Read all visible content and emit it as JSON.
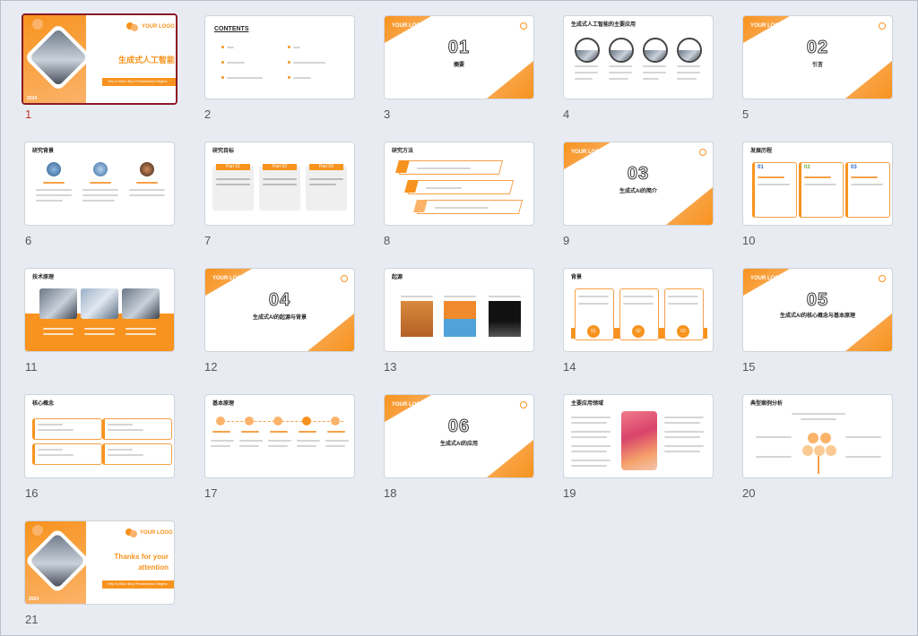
{
  "slides": [
    {
      "n": "1",
      "logo": "YOUR LOGO",
      "title": "生成式人工智能",
      "subtitle": "Hey Is Elton Bey Presentation Begins",
      "tag": "2024"
    },
    {
      "n": "2",
      "title": "CONTENTS"
    },
    {
      "n": "3",
      "logo": "YOUR LOGO",
      "num": "01",
      "title": "摘要"
    },
    {
      "n": "4",
      "title": "生成式人工智能的主要应用"
    },
    {
      "n": "5",
      "logo": "YOUR LOGO",
      "num": "02",
      "title": "引言"
    },
    {
      "n": "6",
      "title": "研究背景"
    },
    {
      "n": "7",
      "title": "研究目标",
      "parts": [
        "Part 01",
        "Part 02",
        "Part 03"
      ]
    },
    {
      "n": "8",
      "title": "研究方法"
    },
    {
      "n": "9",
      "logo": "YOUR LOGO",
      "num": "03",
      "title": "生成式AI的简介"
    },
    {
      "n": "10",
      "title": "发展历程",
      "cards": [
        "01",
        "02",
        "03"
      ]
    },
    {
      "n": "11",
      "title": "技术原理"
    },
    {
      "n": "12",
      "logo": "YOUR LOGO",
      "num": "04",
      "title": "生成式AI的起源与背景"
    },
    {
      "n": "13",
      "title": "起源"
    },
    {
      "n": "14",
      "title": "背景",
      "cards": [
        "01",
        "02",
        "03"
      ]
    },
    {
      "n": "15",
      "logo": "YOUR LOGO",
      "num": "05",
      "title": "生成式AI的核心概念与基本原理"
    },
    {
      "n": "16",
      "title": "核心概念"
    },
    {
      "n": "17",
      "title": "基本原理"
    },
    {
      "n": "18",
      "logo": "YOUR LOGO",
      "num": "06",
      "title": "生成式AI的应用"
    },
    {
      "n": "19",
      "title": "主要应用领域"
    },
    {
      "n": "20",
      "title": "典型案例分析"
    },
    {
      "n": "21",
      "logo": "YOUR LOGO",
      "title": "Thanks for your attention",
      "subtitle": "Hey Is Elton Bey Presentation Begins",
      "tag": "2024"
    }
  ],
  "selected_index": 0,
  "colors": {
    "accent": "#f7931e",
    "selection": "#8b1a24",
    "background": "#e8ecf2"
  }
}
